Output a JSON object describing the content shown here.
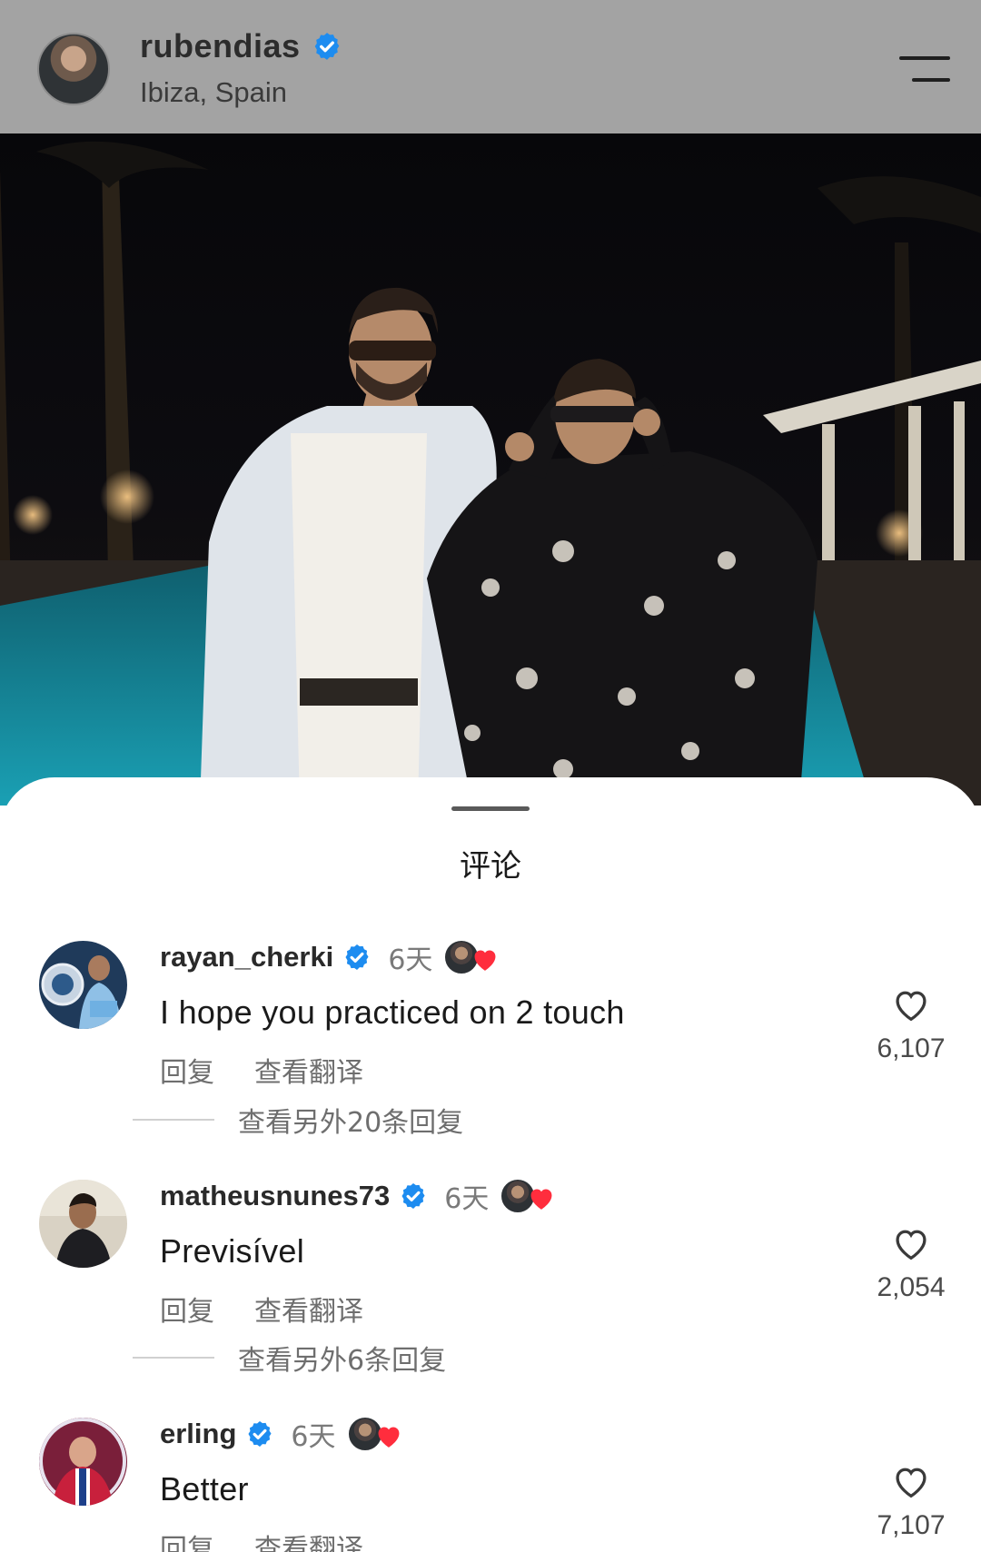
{
  "header": {
    "username": "rubendias",
    "location": "Ibiza, Spain"
  },
  "sheet": {
    "title": "评论"
  },
  "comments": [
    {
      "username": "rayan_cherki",
      "time": "6天",
      "text": "I hope you practiced on 2 touch",
      "reply_label": "回复",
      "translate_label": "查看翻译",
      "likes": "6,107",
      "more_replies": "查看另外20条回复"
    },
    {
      "username": "matheusnunes73",
      "time": "6天",
      "text": "Previsível",
      "reply_label": "回复",
      "translate_label": "查看翻译",
      "likes": "2,054",
      "more_replies": "查看另外6条回复"
    },
    {
      "username": "erling",
      "time": "6天",
      "text": "Better",
      "reply_label": "回复",
      "translate_label": "查看翻译",
      "likes": "7,107"
    }
  ],
  "colors": {
    "verified_blue": "#1d8cf0",
    "heart_red": "#ff2d3d",
    "header_bg": "#a3a3a3"
  },
  "icons": [
    "verified-badge-icon",
    "menu-icon",
    "heart-outline-icon",
    "heart-filled-icon"
  ]
}
